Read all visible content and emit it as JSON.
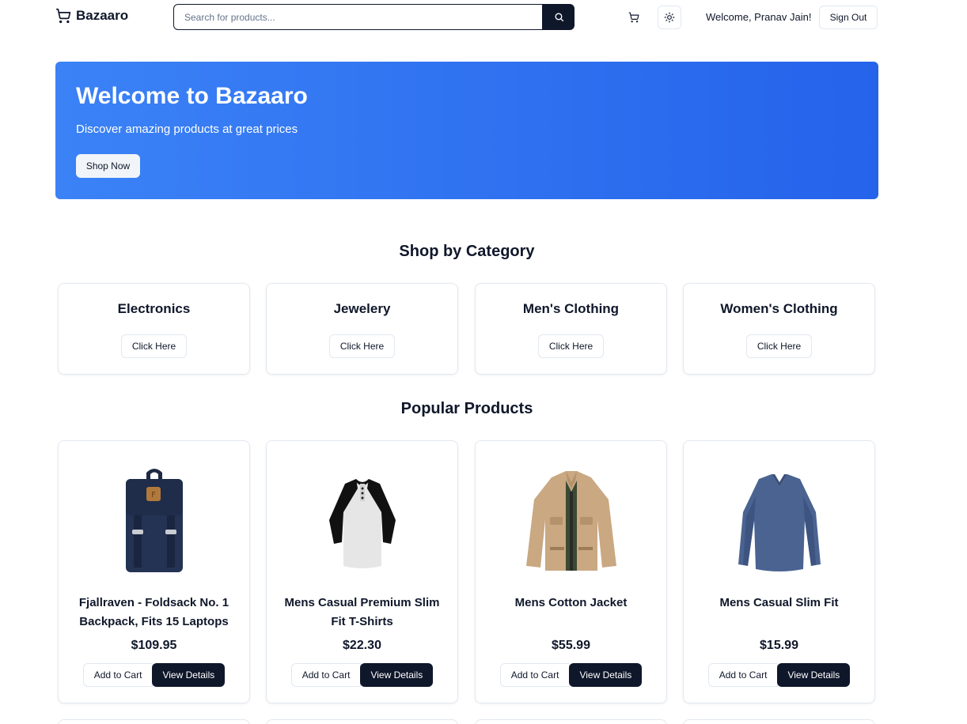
{
  "header": {
    "logo_text": "Bazaaro",
    "search_placeholder": "Search for products...",
    "welcome_text": "Welcome, Pranav Jain!",
    "signout_label": "Sign Out"
  },
  "hero": {
    "title": "Welcome to Bazaaro",
    "subtitle": "Discover amazing products at great prices",
    "cta_label": "Shop Now",
    "gradient_start": "#3b82f6",
    "gradient_end": "#2563eb"
  },
  "categories": {
    "title": "Shop by Category",
    "button_label": "Click Here",
    "items": [
      {
        "name": "Electronics"
      },
      {
        "name": "Jewelery"
      },
      {
        "name": "Men's Clothing"
      },
      {
        "name": "Women's Clothing"
      }
    ]
  },
  "products": {
    "title": "Popular Products",
    "add_to_cart_label": "Add to Cart",
    "view_details_label": "View Details",
    "items": [
      {
        "name": "Fjallraven - Foldsack No. 1 Backpack, Fits 15 Laptops",
        "price": "$109.95",
        "image": "backpack-image"
      },
      {
        "name": "Mens Casual Premium Slim Fit T-Shirts",
        "price": "$22.30",
        "image": "tshirt-image"
      },
      {
        "name": "Mens Cotton Jacket",
        "price": "$55.99",
        "image": "jacket-image"
      },
      {
        "name": "Mens Casual Slim Fit",
        "price": "$15.99",
        "image": "longsleeve-image"
      }
    ]
  },
  "colors": {
    "primary_dark": "#0f172a",
    "border": "#e2e8f0",
    "hero_blue": "#3b82f6"
  }
}
